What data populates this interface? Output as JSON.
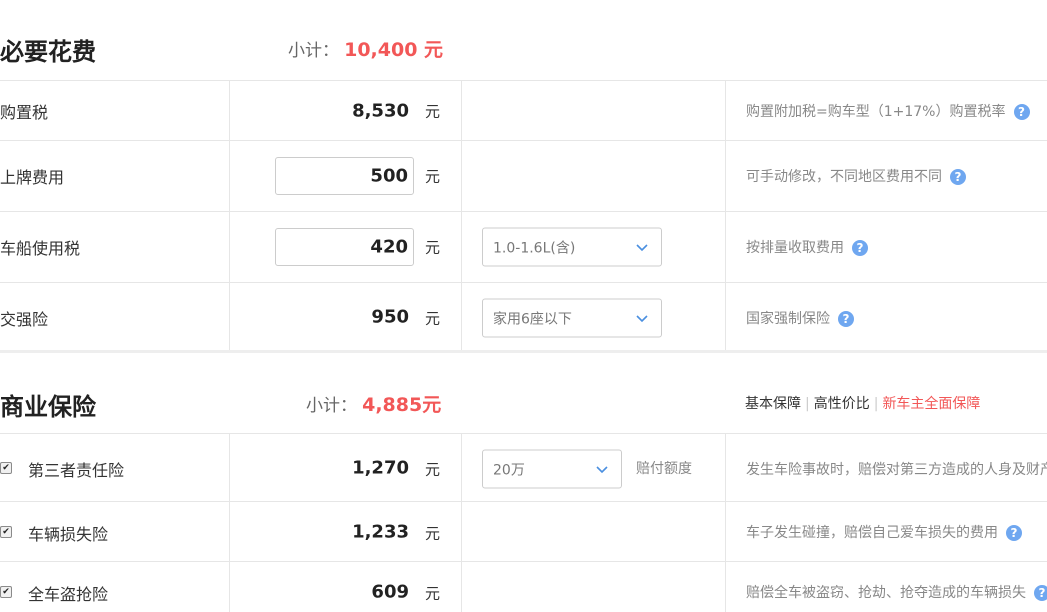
{
  "required": {
    "title": "必要花费",
    "subtotal_label": "小计：",
    "subtotal_value": "10,400 元",
    "rows": [
      {
        "label": "购置税",
        "amount": "8,530",
        "unit": "元",
        "note": "购置附加税=购车型（1+17%）购置税率"
      },
      {
        "label": "上牌费用",
        "input_value": "500",
        "unit": "元",
        "note": "可手动修改，不同地区费用不同"
      },
      {
        "label": "车船使用税",
        "input_value": "420",
        "unit": "元",
        "select_value": "1.0-1.6L(含)",
        "note": "按排量收取费用"
      },
      {
        "label": "交强险",
        "amount": "950",
        "unit": "元",
        "select_value": "家用6座以下",
        "note": "国家强制保险"
      }
    ]
  },
  "commercial": {
    "title": "商业保险",
    "subtotal_label": "小计：",
    "subtotal_value": "4,885元",
    "tabs": [
      "基本保障",
      "高性价比",
      "新车主全面保障"
    ],
    "active_tab": "新车主全面保障",
    "rows": [
      {
        "label": "第三者责任险",
        "checked": true,
        "amount": "1,270",
        "unit": "元",
        "select_value": "20万",
        "select_note": "赔付额度",
        "note": "发生车险事故时，赔偿对第三方造成的人身及财产"
      },
      {
        "label": "车辆损失险",
        "checked": true,
        "amount": "1,233",
        "unit": "元",
        "note": "车子发生碰撞，赔偿自己爱车损失的费用"
      },
      {
        "label": "全车盗抢险",
        "checked": true,
        "amount": "609",
        "unit": "元",
        "note": "赔偿全车被盗窃、抢劫、抢夺造成的车辆损失"
      }
    ]
  },
  "icons": {
    "help": "help-circle-icon",
    "chevron": "chevron-down-icon",
    "checkbox": "checkbox-checked-icon"
  },
  "colors": {
    "accent": "#f25757",
    "help_icon": "#6fa7f0"
  }
}
